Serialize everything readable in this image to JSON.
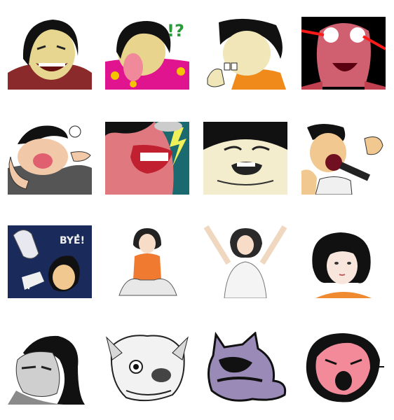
{
  "sheet": {
    "background": "#ffffff",
    "stickers": [
      {
        "name": "grinning-man",
        "icon": "grinning-man-icon"
      },
      {
        "name": "tongue-out-surprised",
        "icon": "tongue-out-icon",
        "caption": "!?"
      },
      {
        "name": "buck-teeth-thumbs-up",
        "icon": "thumbs-up-icon"
      },
      {
        "name": "red-laser-eyes-monster",
        "icon": "laser-eyes-icon"
      },
      {
        "name": "kissing-face-hands",
        "icon": "kiss-icon"
      },
      {
        "name": "angry-red-face-lightning",
        "icon": "angry-face-icon"
      },
      {
        "name": "crying-wide-face",
        "icon": "crying-face-icon"
      },
      {
        "name": "singing-microphone-fist",
        "icon": "microphone-icon"
      },
      {
        "name": "waving-bye-space",
        "icon": "waving-hand-icon",
        "caption": "BYE!"
      },
      {
        "name": "girl-sitting-smiling",
        "icon": "sitting-girl-icon"
      },
      {
        "name": "girl-stretching-arms",
        "icon": "stretching-girl-icon"
      },
      {
        "name": "girl-bob-portrait",
        "icon": "girl-portrait-icon"
      },
      {
        "name": "grayscale-glaring-man",
        "icon": "glaring-man-icon"
      },
      {
        "name": "dog-face-sketch",
        "icon": "dog-face-icon"
      },
      {
        "name": "purple-cat-shadow",
        "icon": "cat-silhouette-icon"
      },
      {
        "name": "pink-screaming-face",
        "icon": "screaming-face-icon"
      }
    ]
  }
}
